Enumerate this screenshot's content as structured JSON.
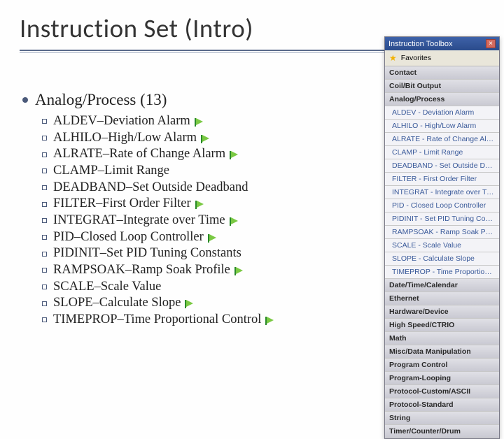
{
  "title": "Instruction Set (Intro)",
  "category": {
    "name": "Analog/Process",
    "count_label": "(13)"
  },
  "items": [
    {
      "name": "ALDEV",
      "desc": "Deviation Alarm",
      "flag": true
    },
    {
      "name": "ALHILO",
      "desc": "High/Low Alarm",
      "flag": true
    },
    {
      "name": "ALRATE",
      "desc": "Rate of Change Alarm",
      "flag": true
    },
    {
      "name": "CLAMP",
      "desc": "Limit Range",
      "flag": false
    },
    {
      "name": "DEADBAND",
      "desc": "Set Outside Deadband",
      "flag": false
    },
    {
      "name": "FILTER",
      "desc": "First Order Filter",
      "flag": true
    },
    {
      "name": "INTEGRAT",
      "desc": "Integrate over Time",
      "flag": true
    },
    {
      "name": "PID",
      "desc": "Closed Loop Controller",
      "flag": true
    },
    {
      "name": "PIDINIT",
      "desc": "Set PID Tuning Constants",
      "flag": false
    },
    {
      "name": "RAMPSOAK",
      "desc": "Ramp Soak Profile",
      "flag": true
    },
    {
      "name": "SCALE",
      "desc": "Scale Value",
      "flag": false
    },
    {
      "name": "SLOPE",
      "desc": "Calculate Slope",
      "flag": true
    },
    {
      "name": "TIMEPROP",
      "desc": "Time Proportional Control",
      "flag": true
    }
  ],
  "toolbox": {
    "title": "Instruction Toolbox",
    "favorites": "Favorites",
    "headers_before": [
      "Contact",
      "Coil/Bit Output"
    ],
    "active_header": "Analog/Process",
    "active_items": [
      "ALDEV - Deviation Alarm",
      "ALHILO - High/Low Alarm",
      "ALRATE - Rate of Change Alarm",
      "CLAMP - Limit Range",
      "DEADBAND - Set Outside Deadband",
      "FILTER - First Order Filter",
      "INTEGRAT - Integrate over Time",
      "PID - Closed Loop Controller",
      "PIDINIT - Set PID Tuning Constants",
      "RAMPSOAK - Ramp Soak Profile",
      "SCALE - Scale Value",
      "SLOPE - Calculate Slope",
      "TIMEPROP - Time Proportional Control"
    ],
    "headers_after": [
      "Date/Time/Calendar",
      "Ethernet",
      "Hardware/Device",
      "High Speed/CTRIO",
      "Math",
      "Misc/Data Manipulation",
      "Program Control",
      "Program-Looping",
      "Protocol-Custom/ASCII",
      "Protocol-Standard",
      "String",
      "Timer/Counter/Drum"
    ]
  }
}
